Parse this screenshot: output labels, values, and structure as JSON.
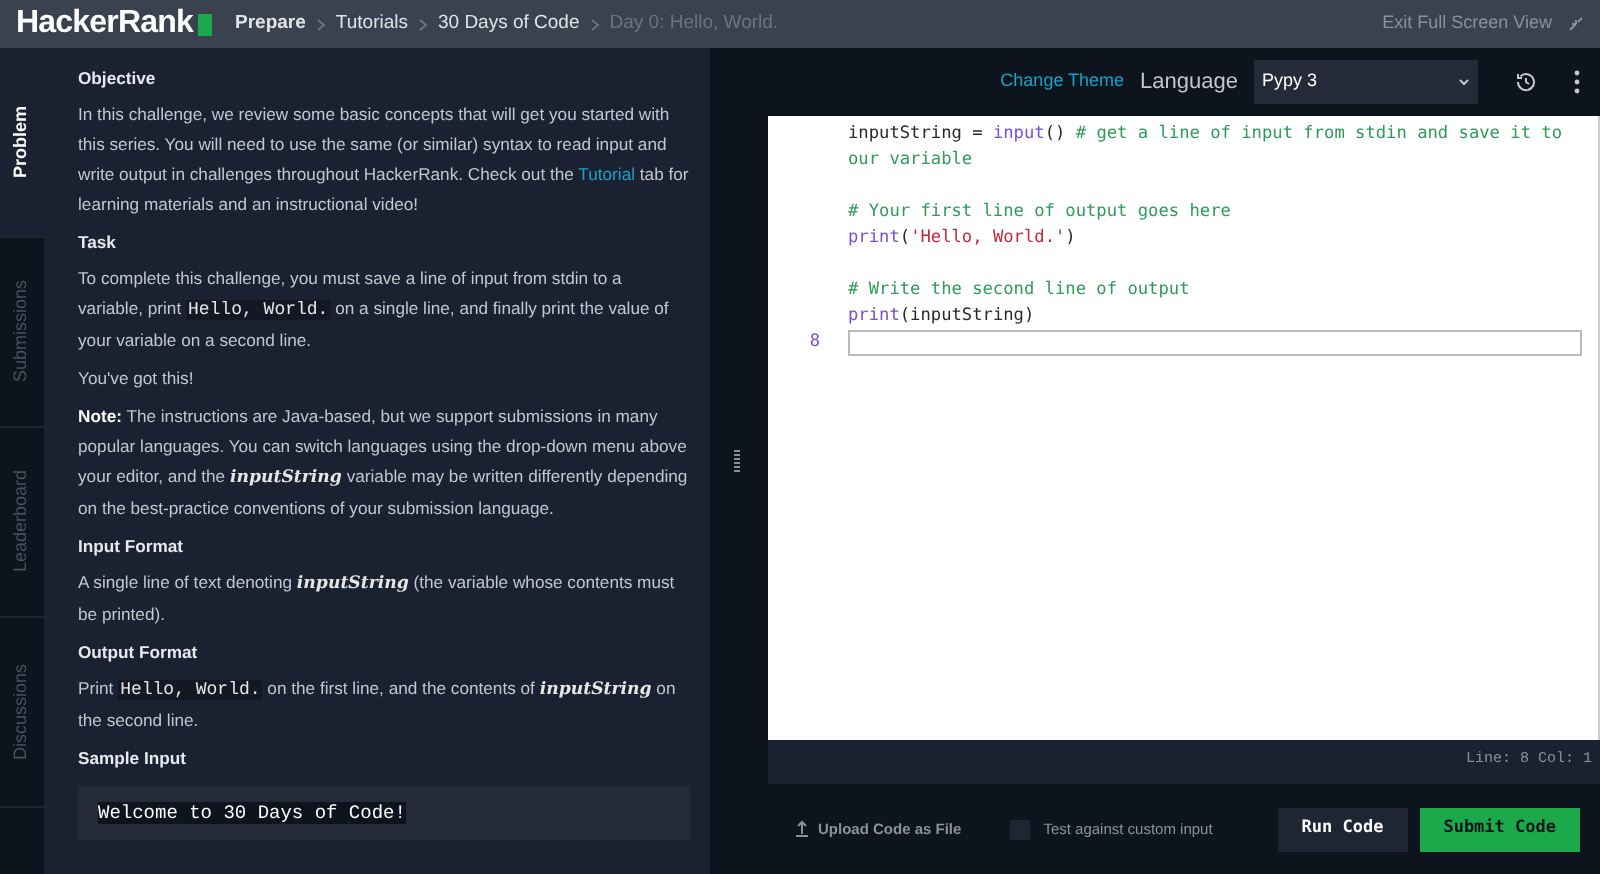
{
  "header": {
    "logo": "HackerRank",
    "breadcrumbs": [
      {
        "label": "Prepare",
        "current": false,
        "bold": true
      },
      {
        "label": "Tutorials",
        "current": false,
        "bold": false
      },
      {
        "label": "30 Days of Code",
        "current": false,
        "bold": false
      },
      {
        "label": "Day 0: Hello, World.",
        "current": true,
        "bold": false
      }
    ],
    "exit": "Exit Full Screen View"
  },
  "side_tabs": [
    {
      "label": "Problem",
      "selected": true
    },
    {
      "label": "Submissions",
      "selected": false
    },
    {
      "label": "Leaderboard",
      "selected": false
    },
    {
      "label": "Discussions",
      "selected": false
    }
  ],
  "problem": [
    {
      "kind": "heading",
      "text": "Objective"
    },
    {
      "kind": "para",
      "segments": [
        {
          "kind": "plain",
          "text": "In this challenge, we review some basic concepts that will get you started with this series. You will need to use the same (or similar) syntax to read input and write output in challenges throughout HackerRank. Check out the "
        },
        {
          "kind": "link",
          "text": "Tutorial"
        },
        {
          "kind": "plain",
          "text": " tab for learning materials and an instructional video!"
        }
      ]
    },
    {
      "kind": "heading",
      "text": "Task"
    },
    {
      "kind": "para",
      "segments": [
        {
          "kind": "plain",
          "text": "To complete this challenge, you must save a line of input from stdin to a variable, print "
        },
        {
          "kind": "code",
          "text": "Hello, World."
        },
        {
          "kind": "plain",
          "text": " on a single line, and finally print the value of your variable on a second line."
        }
      ]
    },
    {
      "kind": "para",
      "segments": [
        {
          "kind": "plain",
          "text": "You've got this!"
        }
      ]
    },
    {
      "kind": "para",
      "segments": [
        {
          "kind": "bold",
          "text": "Note:"
        },
        {
          "kind": "plain",
          "text": " The instructions are Java-based, but we support submissions in many popular languages. You can switch languages using the drop-down menu above your editor, and the "
        },
        {
          "kind": "math",
          "text": "inputString"
        },
        {
          "kind": "plain",
          "text": " variable may be written differently depending on the best-practice conventions of your submission language."
        }
      ]
    },
    {
      "kind": "heading",
      "text": "Input Format"
    },
    {
      "kind": "para",
      "segments": [
        {
          "kind": "plain",
          "text": "A single line of text denoting "
        },
        {
          "kind": "math",
          "text": "inputString"
        },
        {
          "kind": "plain",
          "text": " (the variable whose contents must be printed)."
        }
      ]
    },
    {
      "kind": "heading",
      "text": "Output Format"
    },
    {
      "kind": "para",
      "segments": [
        {
          "kind": "plain",
          "text": "Print "
        },
        {
          "kind": "code",
          "text": "Hello, World."
        },
        {
          "kind": "plain",
          "text": " on the first line, and the contents of "
        },
        {
          "kind": "math",
          "text": "inputString"
        },
        {
          "kind": "plain",
          "text": " on the second line."
        }
      ]
    },
    {
      "kind": "heading",
      "text": "Sample Input"
    },
    {
      "kind": "sample",
      "text": "Welcome to 30 Days of Code!"
    }
  ],
  "editor": {
    "change_theme": "Change Theme",
    "language_label": "Language",
    "language": "Pypy 3",
    "lines": [
      {
        "current": false,
        "segments": [
          {
            "kind": "plain",
            "text": "inputString = "
          },
          {
            "kind": "keyword",
            "text": "input"
          },
          {
            "kind": "plain",
            "text": "() "
          },
          {
            "kind": "comment",
            "text": "# get a line of input from stdin and save it to our variable"
          }
        ]
      },
      {
        "current": false
      },
      {
        "current": false,
        "segments": [
          {
            "kind": "comment",
            "text": "# Your first line of output goes here"
          }
        ]
      },
      {
        "current": false,
        "segments": [
          {
            "kind": "keyword",
            "text": "print"
          },
          {
            "kind": "plain",
            "text": "("
          },
          {
            "kind": "string",
            "text": "'Hello, World.'"
          },
          {
            "kind": "plain",
            "text": ")"
          }
        ]
      },
      {
        "current": false
      },
      {
        "current": false,
        "segments": [
          {
            "kind": "comment",
            "text": "# Write the second line of output"
          }
        ]
      },
      {
        "current": false,
        "segments": [
          {
            "kind": "keyword",
            "text": "print"
          },
          {
            "kind": "plain",
            "text": "(inputString)"
          }
        ]
      },
      {
        "current": true,
        "number": "8"
      }
    ],
    "status": "Line: 8 Col: 1"
  },
  "footer": {
    "upload": "Upload Code as File",
    "custom_input": {
      "label": "Test against custom input",
      "checked": false
    },
    "run": "Run Code",
    "submit": "Submit Code"
  }
}
